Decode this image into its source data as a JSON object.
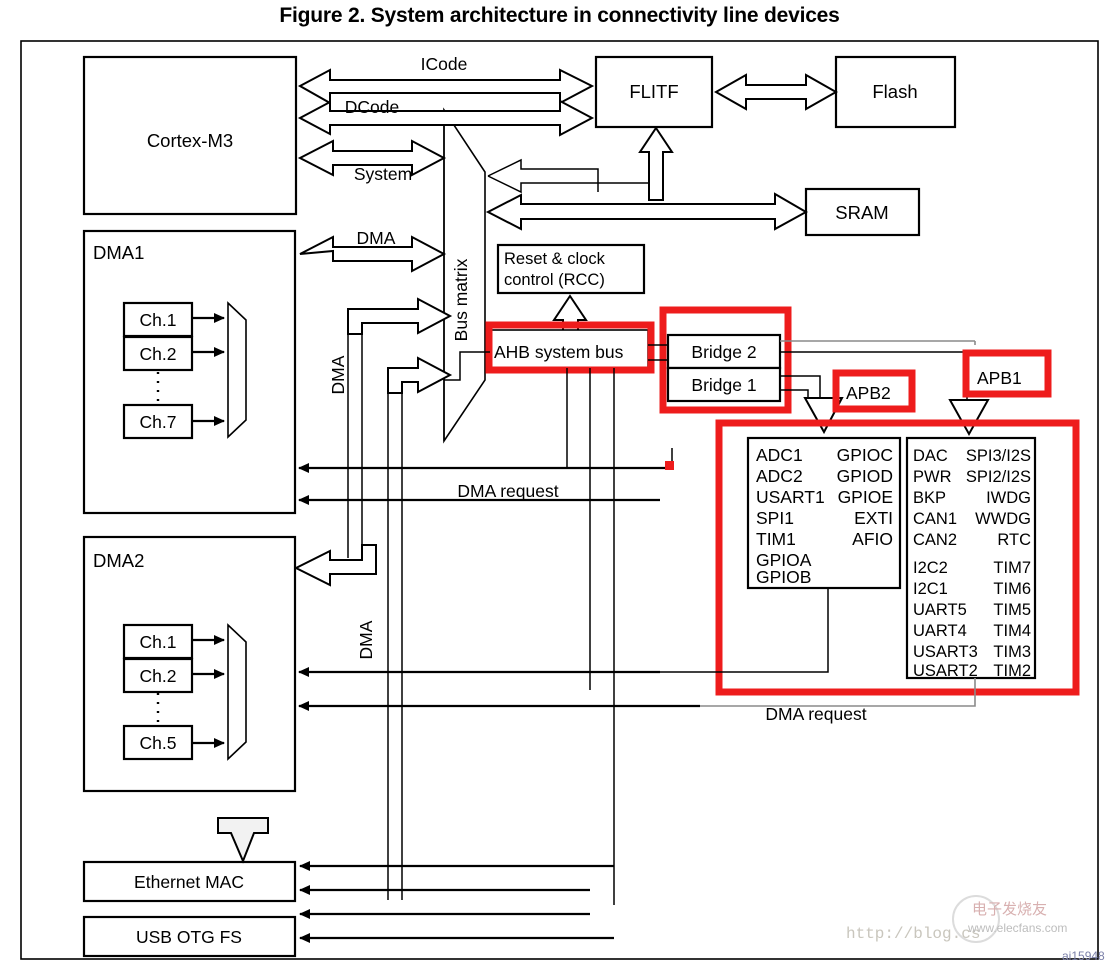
{
  "figure": {
    "title": "Figure 2. System architecture in connectivity line devices",
    "figure_id": "ai15948"
  },
  "blocks": {
    "cortex": "Cortex-M3",
    "flitf": "FLITF",
    "flash": "Flash",
    "sram": "SRAM",
    "rcc": [
      "Reset & clock",
      "control (RCC)"
    ],
    "bus_matrix": "Bus matrix",
    "ahb_bus": "AHB system bus",
    "bridge2": "Bridge  2",
    "bridge1": "Bridge  1",
    "apb2_label": "APB2",
    "apb1_label": "APB1",
    "dma1": "DMA1",
    "dma2": "DMA2",
    "ethernet": "Ethernet MAC",
    "usb": "USB OTG FS"
  },
  "bus_labels": {
    "icode": "ICode",
    "dcode": "DCode",
    "system": "System",
    "dma_top": "DMA",
    "dma_vert1": "DMA",
    "dma_vert2": "DMA",
    "dma_request_1": "DMA request",
    "dma_request_2": "DMA request"
  },
  "dma1_channels": [
    "Ch.1",
    "Ch.2",
    "Ch.7"
  ],
  "dma2_channels": [
    "Ch.1",
    "Ch.2",
    "Ch.5"
  ],
  "apb2_peripherals": {
    "left": [
      "ADC1",
      "ADC2",
      "USART1",
      "SPI1",
      "TIM1",
      "GPIOA",
      "GPIOB"
    ],
    "right": [
      "GPIOC",
      "GPIOD",
      "GPIOE",
      "EXTI",
      "AFIO"
    ]
  },
  "apb1_peripherals": {
    "left": [
      "DAC",
      "PWR",
      "BKP",
      "CAN1",
      "CAN2",
      "I2C2",
      "I2C1",
      "UART5",
      "UART4",
      "USART3",
      "USART2"
    ],
    "right": [
      "SPI3/I2S",
      "SPI2/I2S",
      "IWDG",
      "WWDG",
      "RTC",
      "TIM7",
      "TIM6",
      "TIM5",
      "TIM4",
      "TIM3",
      "TIM2"
    ]
  },
  "watermark": {
    "url": "http://blog.cs",
    "cn": "电子发烧友",
    "site": "www.elecfans.com"
  },
  "colors": {
    "highlight": "#ee1c1c",
    "line": "#000000",
    "gray_line": "#8a8a8a",
    "background": "#ffffff"
  }
}
